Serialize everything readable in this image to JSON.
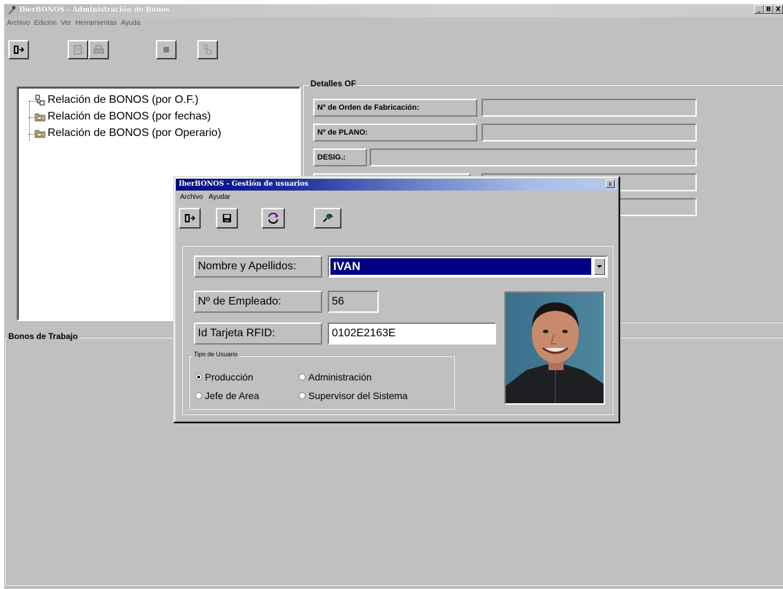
{
  "main_window": {
    "title": "IberBONOS - Administración de Bonos",
    "window_buttons": [
      "_",
      "B",
      "X"
    ],
    "menu": [
      "Archivo",
      "Edicion",
      "Ver",
      "Herramientas",
      "Ayuda"
    ],
    "toolbar_icons": [
      "exit-icon",
      "document-icon",
      "print-icon",
      "stop-icon",
      "report-icon"
    ]
  },
  "tree": {
    "items": [
      {
        "label": "Relación de BONOS (por O.F.)",
        "icon": "network-icon"
      },
      {
        "label": "Relación de BONOS (por fechas)",
        "icon": "folder-icon"
      },
      {
        "label": "Relación de BONOS (por Operario)",
        "icon": "folder-icon"
      }
    ]
  },
  "details": {
    "group_title": "Detalles OF",
    "fields": [
      {
        "label": "Nº de Orden de Fabricación:",
        "value": ""
      },
      {
        "label": "Nº de PLANO:",
        "value": ""
      },
      {
        "label": "DESIG.:",
        "value": ""
      }
    ]
  },
  "bonos": {
    "group_title": "Bonos de Trabajo"
  },
  "dialog": {
    "title": "IberBONOS - Gestión de usuarios",
    "close_label": "x",
    "menu": [
      "Archivo",
      "Ayudar"
    ],
    "toolbar_icons": [
      "exit-icon",
      "save-icon",
      "refresh-icon",
      "connect-icon"
    ],
    "name_label": "Nombre y Apellidos:",
    "name_value": "IVAN",
    "employee_label": "Nº de Empleado:",
    "employee_value": "56",
    "rfid_label": "Id Tarjeta RFID:",
    "rfid_value": "0102E2163E",
    "user_type": {
      "title": "Tipo de Usuario",
      "options": [
        {
          "label": "Producción",
          "checked": true
        },
        {
          "label": "Administración",
          "checked": false
        },
        {
          "label": "Jefe de Area",
          "checked": false
        },
        {
          "label": "Supervisor del Sistema",
          "checked": false
        }
      ]
    }
  }
}
